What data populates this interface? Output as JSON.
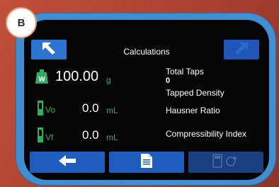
{
  "badge": {
    "label": "B"
  },
  "header": {
    "title": "Calculations"
  },
  "measurements": {
    "weight": {
      "icon_letter": "W",
      "value": "100.00",
      "unit": "g"
    },
    "vo": {
      "label": "Vo",
      "value": "0.0",
      "unit": "mL"
    },
    "vf": {
      "label": "Vf",
      "value": "0.0",
      "unit": "mL"
    }
  },
  "results": {
    "total_taps_label": "Total Taps",
    "total_taps_value": "0",
    "tapped_density_label": "Tapped Density",
    "hausner_ratio_label": "Hausner Ratio",
    "compressibility_index_label": "Compressibility Index"
  },
  "icons": {
    "top_left": "arrow-up-left-icon",
    "top_right": "arrow-up-right-icon",
    "back": "arrow-left-icon",
    "report": "document-icon",
    "calc_refresh": "calculator-refresh-icon"
  },
  "colors": {
    "accent_blue": "#2a74d2",
    "screen_bg": "#050505",
    "unit_green": "#2fae62",
    "frame_blue": "#3f8fd2"
  }
}
